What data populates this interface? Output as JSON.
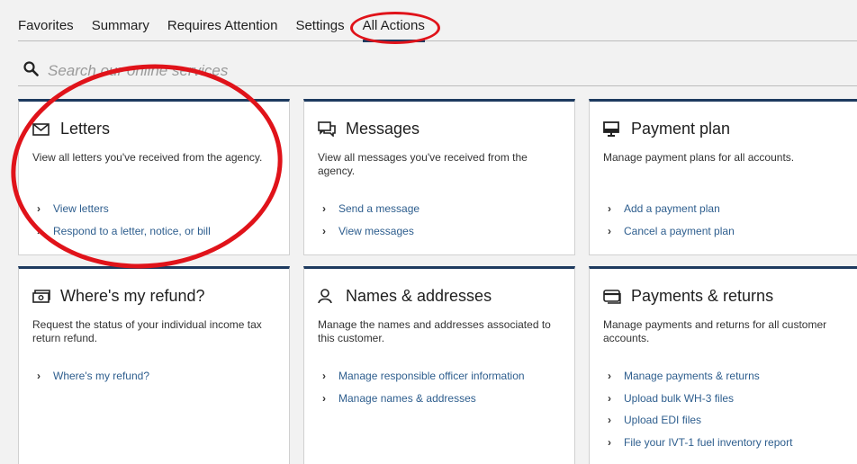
{
  "tabs": [
    {
      "label": "Favorites"
    },
    {
      "label": "Summary"
    },
    {
      "label": "Requires Attention"
    },
    {
      "label": "Settings"
    },
    {
      "label": "All Actions",
      "active": true
    }
  ],
  "search": {
    "placeholder": "Search our online services"
  },
  "cards": [
    {
      "title": "Letters",
      "icon": "envelope-icon",
      "description": "View all letters you've received from the agency.",
      "links": [
        "View letters",
        "Respond to a letter, notice, or bill"
      ]
    },
    {
      "title": "Messages",
      "icon": "chat-icon",
      "description": "View all messages you've received from the agency.",
      "links": [
        "Send a message",
        "View messages"
      ]
    },
    {
      "title": "Payment plan",
      "icon": "monitor-icon",
      "description": "Manage payment plans for all accounts.",
      "links": [
        "Add a payment plan",
        "Cancel a payment plan"
      ]
    },
    {
      "title": "Where's my refund?",
      "icon": "cash-icon",
      "description": "Request the status of your individual income tax return refund.",
      "links": [
        "Where's my refund?"
      ]
    },
    {
      "title": "Names & addresses",
      "icon": "person-icon",
      "description": "Manage the names and addresses associated to this customer.",
      "links": [
        "Manage responsible officer information",
        "Manage names & addresses"
      ]
    },
    {
      "title": "Payments & returns",
      "icon": "card-icon",
      "description": "Manage payments and returns for all customer accounts.",
      "links": [
        "Manage payments & returns",
        "Upload bulk WH-3 files",
        "Upload EDI files",
        "File your IVT-1 fuel inventory report"
      ]
    }
  ],
  "colors": {
    "accent": "#1d3a5f",
    "link": "#2e5e8e",
    "annotation": "#e0131a"
  }
}
